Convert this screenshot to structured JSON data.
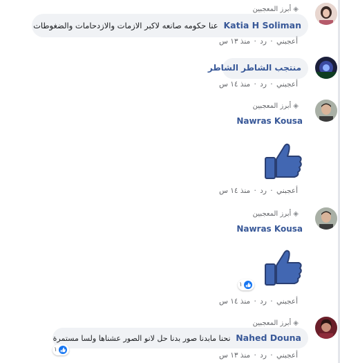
{
  "labels": {
    "top_fan": "أبرز المعجبين",
    "like": "أعجبني",
    "reply": "رد",
    "dot": "·"
  },
  "comments": [
    {
      "author": "Katia H Soliman",
      "text": "عنا حكومه صانعه لاكبر الازمات والازدحامات والضغوطات",
      "time": "منذ ١٣ س",
      "top_fan": true
    },
    {
      "author": "منتجب الشاطر الشاطر",
      "text": "",
      "time": "منذ ١٤ س",
      "top_fan": false
    },
    {
      "author": "Nawras Kousa",
      "text": "",
      "time": "منذ ١٤ س",
      "top_fan": true,
      "sticker": "thumbs-up-icon"
    },
    {
      "author": "Nawras Kousa",
      "text": "",
      "time": "منذ ١٤ س",
      "top_fan": true,
      "sticker": "thumbs-up-icon",
      "reaction_count": "١"
    },
    {
      "author": "Nahed Douna",
      "text": "نحنا مابدنا صور بدنا حل لانو الصور عشناها ولسا مستمرة",
      "time": "منذ ١٣ س",
      "top_fan": true,
      "reaction_count": "١"
    }
  ],
  "colors": {
    "author": "#385898",
    "bubble": "#f0f2f5",
    "like_blue": "#1877f2",
    "sticker_blue": "#4267b2"
  }
}
